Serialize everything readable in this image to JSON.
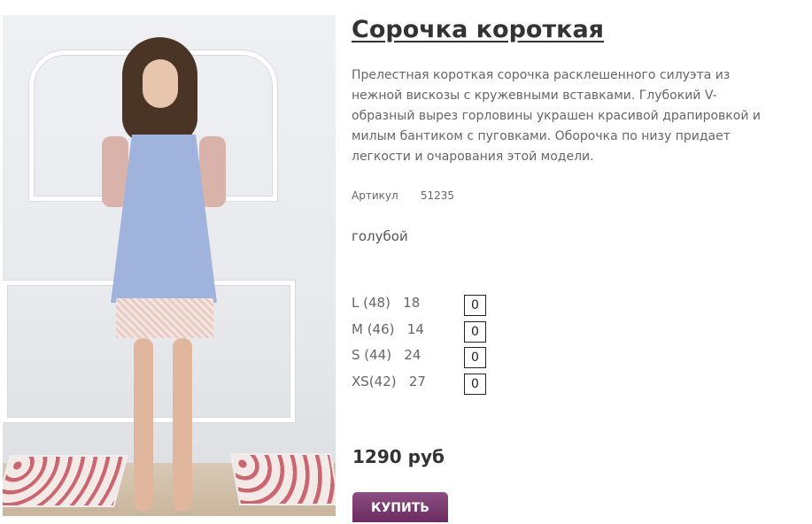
{
  "product": {
    "title": "Сорочка короткая",
    "description": "Прелестная короткая сорочка расклешенного силуэта из нежной вискозы с кружевными вставками. Глубокий V-образный вырез горловины украшен красивой драпировкой и милым бантиком с пуговками. Оборочка по низу придает легкости и очарования этой модели.",
    "article_label": "Артикул",
    "article_value": "51235",
    "color": "голубой",
    "sizes": [
      {
        "label": "L (48)   18",
        "qty": "0"
      },
      {
        "label": "M (46)   14",
        "qty": "0"
      },
      {
        "label": "S (44)   24",
        "qty": "0"
      },
      {
        "label": "XS(42)   27",
        "qty": "0"
      }
    ],
    "price": "1290 руб",
    "buy_label": "КУПИТЬ"
  },
  "colors": {
    "buy_button": "#7a3a6f",
    "title": "#333333",
    "dress": "#9fb3dd"
  }
}
